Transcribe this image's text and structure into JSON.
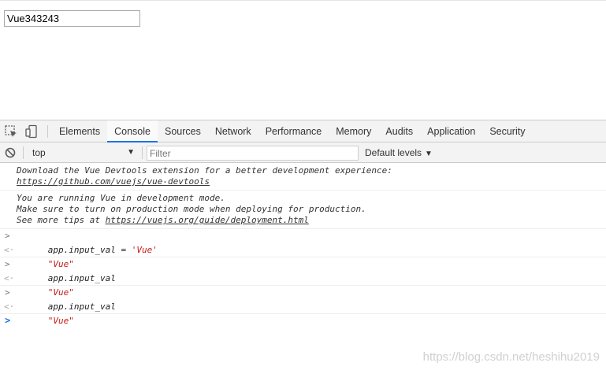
{
  "page": {
    "input_value": "Vue343243"
  },
  "devtools": {
    "tabs": [
      "Elements",
      "Console",
      "Sources",
      "Network",
      "Performance",
      "Memory",
      "Audits",
      "Application",
      "Security"
    ],
    "active_tab": "Console",
    "icons": {
      "inspect": "cursor-inspect-icon",
      "device": "device-toolbar-icon",
      "clear": "clear-console-icon"
    },
    "filterbar": {
      "context": "top",
      "context_arrow": "▼",
      "filter_placeholder": "Filter",
      "levels": "Default levels",
      "levels_arrow": "▼"
    },
    "console": {
      "info1_line1": "Download the Vue Devtools extension for a better development experience:",
      "info1_link": "https://github.com/vuejs/vue-devtools",
      "info2_line1": "You are running Vue in development mode.",
      "info2_line2": "Make sure to turn on production mode when deploying for production.",
      "info2_line3_prefix": "See more tips at ",
      "info2_link": "https://vuejs.org/guide/deployment.html",
      "cmd1_lhs": "app.input_val",
      "cmd1_op": " = ",
      "cmd1_rhs": "'Vue'",
      "result1": "\"Vue\"",
      "cmd2": "app.input_val",
      "result2": "\"Vue\"",
      "cmd3": "app.input_val",
      "result3": "\"Vue\"",
      "prompt_glyph": ">",
      "result_glyph": "<·",
      "caret_glyph": ">"
    },
    "colors": {
      "accent": "#1a73e8",
      "string": "#c41a16"
    }
  },
  "watermark": "https://blog.csdn.net/heshihu2019"
}
